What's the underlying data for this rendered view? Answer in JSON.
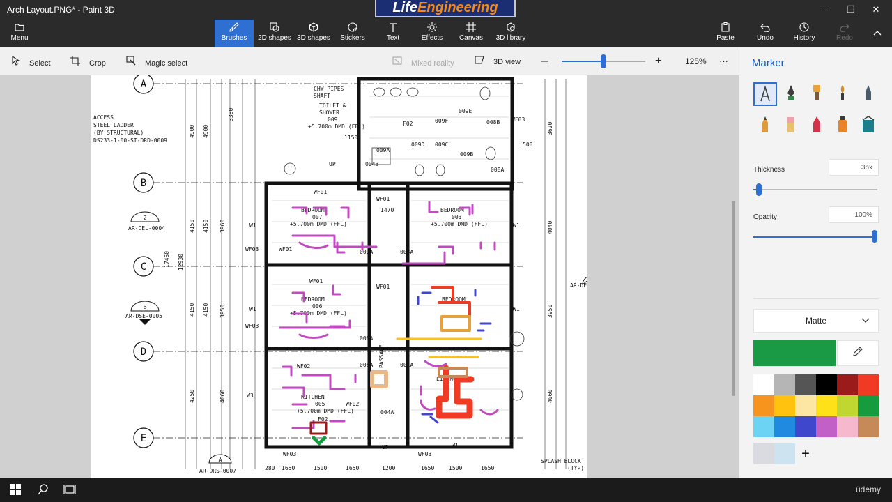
{
  "window": {
    "title": "Arch Layout.PNG* - Paint 3D",
    "controls": {
      "minimize": "—",
      "maximize": "❐",
      "close": "✕"
    }
  },
  "brand_logo": {
    "part1": "Life",
    "part2": "Engineering"
  },
  "toolbar": {
    "menu": {
      "label": "Menu",
      "icon": "folder-icon"
    },
    "tools": [
      {
        "label": "Brushes",
        "icon": "brush-icon",
        "active": true
      },
      {
        "label": "2D shapes",
        "icon": "2d-shapes-icon"
      },
      {
        "label": "3D shapes",
        "icon": "3d-shapes-icon"
      },
      {
        "label": "Stickers",
        "icon": "sticker-icon"
      },
      {
        "label": "Text",
        "icon": "text-icon"
      },
      {
        "label": "Effects",
        "icon": "effects-icon"
      },
      {
        "label": "Canvas",
        "icon": "canvas-icon"
      },
      {
        "label": "3D library",
        "icon": "library-icon"
      }
    ],
    "paste": "Paste",
    "undo": "Undo",
    "history": "History",
    "redo": "Redo"
  },
  "subbar": {
    "select": "Select",
    "crop": "Crop",
    "magic_select": "Magic select",
    "mixed_reality": "Mixed reality",
    "view_3d": "3D view",
    "zoom_minus": "—",
    "zoom_plus": "+",
    "zoom": "125%",
    "zoom_level": 0.5,
    "more": "···"
  },
  "drawing": {
    "grid_labels": [
      "A",
      "B",
      "C",
      "D",
      "E"
    ],
    "texts": {
      "access": "ACCESS",
      "ladder": "STEEL LADDER",
      "structural": "(BY STRUCTURAL)",
      "ref": "DS233-1-00-ST-DRD-0009",
      "chw": "CHW PIPES",
      "shaft": "SHAFT",
      "toilet": "TOILET &",
      "shower": "SHOWER",
      "t_no": "009",
      "t_lvl": "+5.700m DMD (FFL)",
      "bed1": "BEDROOM",
      "bed1_no": "007",
      "bed1_lvl": "+5.700m DMD (FFL)",
      "bed2": "BEDROOM",
      "bed2_no": "003",
      "bed2_lvl": "+5.700m DMD (FFL)",
      "bed3": "BEDROOM",
      "bed3_no": "006",
      "bed3_lvl": "+5.700m DMD (FFL)",
      "bed4": "BEDROOM",
      "kitchen": "KITCHEN",
      "kit_no": "005",
      "kit_lvl": "+5.700m DMD (FFL)",
      "living": "LIVING ROOM",
      "passage": "PASSAGE",
      "ref2": "AR-DEL-0004",
      "ref3": "AR-DSE-0005",
      "ref4": "AR-DRS-0007",
      "ref5": "AR-DE",
      "splash": "SPLASH BLOCK",
      "typ": "(TYP)",
      "sec2": "2",
      "secB": "B",
      "secA": "A",
      "w1": "W1",
      "w3": "W3",
      "wf03": "WF03",
      "wf01": "WF01",
      "wf02": "WF02",
      "f02": "F02",
      "up": "UP",
      "d007a": "007A",
      "d003a": "003A",
      "d009a": "009A",
      "d004b": "004B",
      "d008a": "008A",
      "d009e": "009E",
      "d009f": "009F",
      "d008b": "008B",
      "d009d": "009D",
      "d009c": "009C",
      "d009b": "009B",
      "d006a": "006A",
      "d005a": "005A",
      "d001a": "001A",
      "d004a": "004A",
      "dim1": "4900",
      "dim2": "4150",
      "dim3": "4150",
      "dim4": "4250",
      "dim5": "17450",
      "dim6": "3380",
      "dim7": "3960",
      "dim8": "3950",
      "dim9": "4060",
      "dim10": "12930",
      "dim11": "1650",
      "dim12": "1500",
      "dim13": "1200",
      "dim14": "3620",
      "dim15": "4040",
      "dim16": "500",
      "dim17": "1470",
      "dim18": "1150",
      "dim19": "280"
    }
  },
  "panel": {
    "title": "Marker",
    "brushes": [
      {
        "icon": "marker-icon",
        "color": "#3b3b3b",
        "selected": true
      },
      {
        "icon": "calligraphy-pen-icon",
        "color": "#2f8a4a"
      },
      {
        "icon": "oil-brush-icon",
        "color": "#e8a33a"
      },
      {
        "icon": "watercolor-icon",
        "color": "#d08a2a"
      },
      {
        "icon": "pixel-pen-icon",
        "color": "#4a5a6a"
      },
      {
        "icon": "pencil-icon",
        "color": "#e09a3a"
      },
      {
        "icon": "eraser-icon",
        "color": "#f0a0a8"
      },
      {
        "icon": "crayon-icon",
        "color": "#d0334a"
      },
      {
        "icon": "spray-can-icon",
        "color": "#e8842a"
      },
      {
        "icon": "fill-icon",
        "color": "#1a7f8a"
      }
    ],
    "thickness_label": "Thickness",
    "thickness_value": "3px",
    "thickness_level": 0.02,
    "opacity_label": "Opacity",
    "opacity_value": "100%",
    "opacity_level": 1.0,
    "finish": "Matte",
    "current_color": "#1a9a44",
    "palette": [
      "#ffffff",
      "#b5b5b5",
      "#555555",
      "#000000",
      "#9b1b1b",
      "#f03a23",
      "#f7941d",
      "#ffc20e",
      "#fde6a3",
      "#ffe11a",
      "#bfd730",
      "#169c3f",
      "#6dd3f5",
      "#1f8ae0",
      "#3f48cc",
      "#c260c7",
      "#f5b8cc",
      "#c68a58"
    ],
    "custom_colors": [
      "#d9dbe0",
      "#cde3ef"
    ],
    "add_color": "+"
  },
  "taskbar": {
    "watermark": "ūdemy"
  }
}
